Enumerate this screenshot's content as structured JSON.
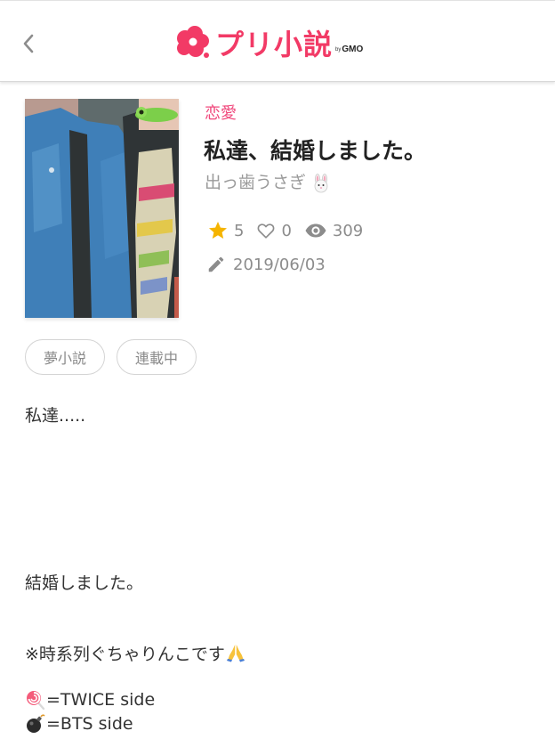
{
  "header": {
    "logo_text": "プリ小説",
    "logo_by": "by",
    "logo_brand": "GMO",
    "brand_color": "#f23a66"
  },
  "novel": {
    "genre": "恋愛",
    "title": "私達、結婚しました。",
    "author": "出っ歯うさぎ",
    "author_icon": "rabbit-face-icon",
    "stats": {
      "stars": "5",
      "likes": "0",
      "views": "309"
    },
    "date": "2019/06/03",
    "tags": [
      "夢小説",
      "連載中"
    ]
  },
  "synopsis": {
    "line1": "私達.....",
    "line2": "結婚しました。",
    "line3": "※時系列ぐちゃりんこです",
    "line3_icon": "folded-hands-icon",
    "line4": "=TWICE side",
    "line4_icon": "lollipop-icon",
    "line5": "=BTS side",
    "line5_icon": "bomb-icon"
  }
}
